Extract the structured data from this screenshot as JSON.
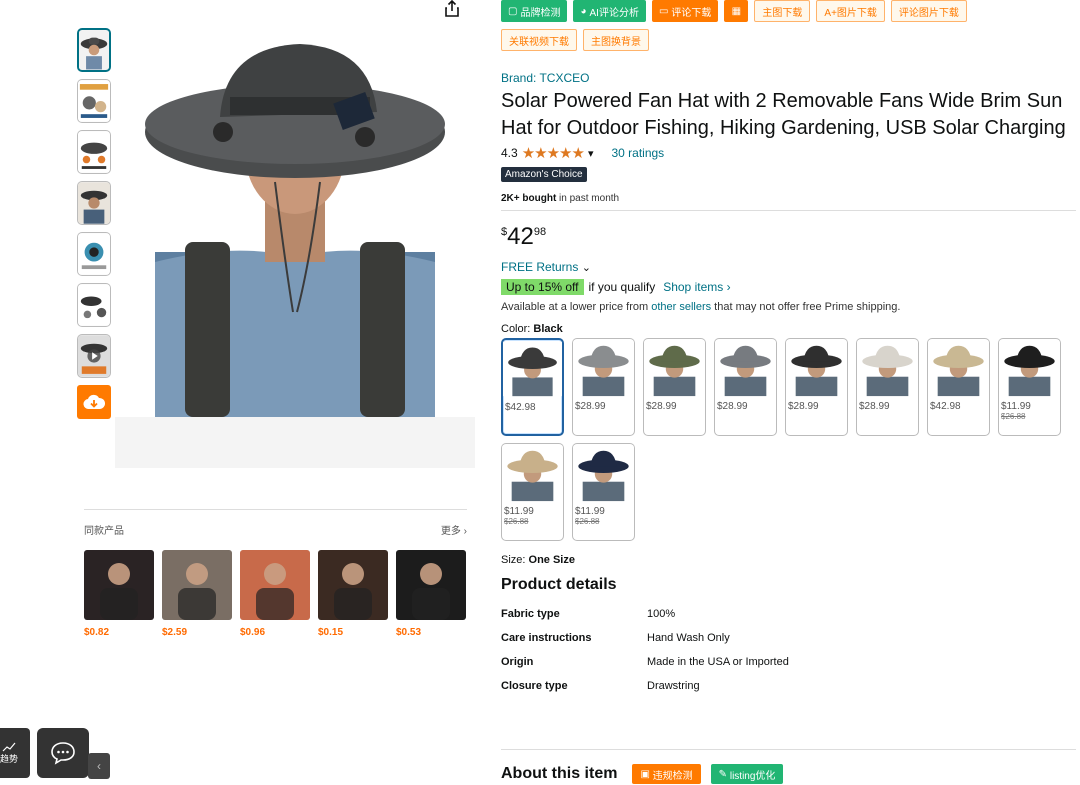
{
  "toolbar": {
    "row1": [
      {
        "label": "品牌检测",
        "style": "green",
        "icon": "square-icon"
      },
      {
        "label": "AI评论分析",
        "style": "green",
        "icon": "pie-icon"
      },
      {
        "label": "评论下载",
        "style": "orange",
        "icon": "comment-icon"
      },
      {
        "label": "",
        "style": "orange",
        "icon": "calculator-icon"
      },
      {
        "label": "主图下载",
        "style": "outline"
      },
      {
        "label": "A+图片下载",
        "style": "outline"
      },
      {
        "label": "评论图片下载",
        "style": "outline"
      }
    ],
    "row2": [
      {
        "label": "关联视频下载",
        "style": "outline"
      },
      {
        "label": "主图换背景",
        "style": "outline"
      }
    ]
  },
  "product": {
    "brand": "Brand: TCXCEO",
    "title": "Solar Powered Fan Hat with 2 Removable Fans Wide Brim Sun Hat for Outdoor Fishing, Hiking Gardening, USB Solar Charging",
    "rating": "4.3",
    "stars": "★★★★★",
    "ratings_count": "30 ratings",
    "badge": "Amazon's Choice",
    "bought_bold": "2K+ bought",
    "bought_rest": " in past month",
    "price_symbol": "$",
    "price_whole": "42",
    "price_fraction": "98",
    "returns": "FREE Returns",
    "promo_badge": "Up to 15% off",
    "promo_text": "if you qualify",
    "shop_items": "Shop items ›",
    "lower_prefix": "Available at a lower price from ",
    "lower_link": "other sellers",
    "lower_suffix": " that may not offer free Prime shipping.",
    "color_label": "Color: ",
    "color_value": "Black",
    "size_label": "Size: ",
    "size_value": "One Size"
  },
  "swatches": [
    {
      "price": "$42.98",
      "old": "",
      "selected": true,
      "hat": "#3a3a3a"
    },
    {
      "price": "$28.99",
      "old": "",
      "selected": false,
      "hat": "#8a8d8f"
    },
    {
      "price": "$28.99",
      "old": "",
      "selected": false,
      "hat": "#5f6b4a"
    },
    {
      "price": "$28.99",
      "old": "",
      "selected": false,
      "hat": "#777b80"
    },
    {
      "price": "$28.99",
      "old": "",
      "selected": false,
      "hat": "#2f2f2f"
    },
    {
      "price": "$28.99",
      "old": "",
      "selected": false,
      "hat": "#d8d4cc"
    },
    {
      "price": "$42.98",
      "old": "",
      "selected": false,
      "hat": "#c9b893"
    },
    {
      "price": "$11.99",
      "old": "$26.88",
      "selected": false,
      "hat": "#1e1e1e"
    },
    {
      "price": "$11.99",
      "old": "$26.88",
      "selected": false,
      "hat": "#c8b08a"
    },
    {
      "price": "$11.99",
      "old": "$26.88",
      "selected": false,
      "hat": "#1f2a44"
    }
  ],
  "details": {
    "heading": "Product details",
    "rows": [
      {
        "k": "Fabric type",
        "v": "100%"
      },
      {
        "k": "Care instructions",
        "v": "Hand Wash Only"
      },
      {
        "k": "Origin",
        "v": "Made in the USA or Imported"
      },
      {
        "k": "Closure type",
        "v": "Drawstring"
      }
    ]
  },
  "about": {
    "heading": "About this item",
    "btn1": "违规检测",
    "btn2": "listing优化"
  },
  "similar": {
    "title": "同款产品",
    "more": "更多 ›",
    "items": [
      {
        "price": "$0.82",
        "bg": "#2a2324"
      },
      {
        "price": "$2.59",
        "bg": "#7a6e64"
      },
      {
        "price": "$0.96",
        "bg": "#c86a4a"
      },
      {
        "price": "$0.15",
        "bg": "#3b2a22"
      },
      {
        "price": "$0.53",
        "bg": "#1c1c1c"
      }
    ]
  },
  "floating": {
    "trend_label": "趋势"
  },
  "colors": {
    "link": "#007185",
    "green": "#21b573",
    "orange": "#ff7a00",
    "star": "#de7921"
  }
}
